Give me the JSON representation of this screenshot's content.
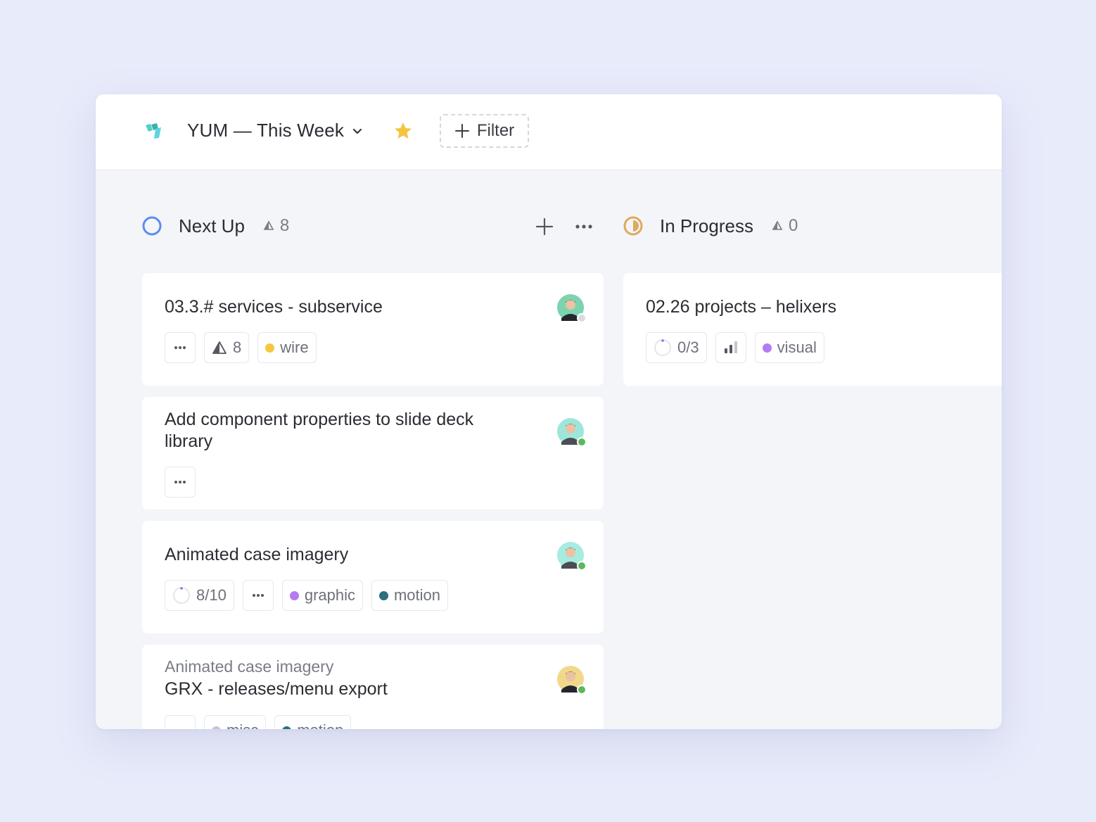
{
  "header": {
    "board_title": "YUM — This Week",
    "filter_label": "Filter"
  },
  "columns": [
    {
      "name": "Next Up",
      "count": "8",
      "status_color": "#5b8def",
      "cards": [
        {
          "title": "03.3.# services - subservice",
          "estimate": "8",
          "tags": [
            {
              "label": "wire",
              "color": "#f5c842"
            }
          ],
          "assignee_bg": "#7dd3b0",
          "presence_color": "#d9dbe0"
        },
        {
          "title_line1": "Add component properties to slide deck",
          "title_line2": "library",
          "assignee_bg": "#9ee6dc",
          "presence_color": "#5cb85c"
        },
        {
          "title": "Animated case imagery",
          "progress": "8/10",
          "tags": [
            {
              "label": "graphic",
              "color": "#b57bf0"
            },
            {
              "label": "motion",
              "color": "#2e6e7e"
            }
          ],
          "assignee_bg": "#a6ece0",
          "presence_color": "#5cb85c"
        },
        {
          "subtitle": "Animated case imagery",
          "title": "GRX - releases/menu export",
          "tags": [
            {
              "label": "misc",
              "color": "#c4c6cc"
            },
            {
              "label": "motion",
              "color": "#2e6e7e"
            }
          ],
          "assignee_bg": "#f2d88a",
          "presence_color": "#5cb85c"
        }
      ]
    },
    {
      "name": "In Progress",
      "count": "0",
      "status_color": "#e0a95c",
      "cards": [
        {
          "title": "02.26 projects – helixers",
          "progress": "0/3",
          "tags": [
            {
              "label": "visual",
              "color": "#b57bf0"
            }
          ]
        }
      ]
    }
  ],
  "icons": {
    "logo": "app-logo-icon",
    "star": "star-icon",
    "add": "plus-icon",
    "more": "ellipsis-icon",
    "estimate": "triangle-estimate-icon",
    "priority": "bar-chart-icon",
    "progress": "progress-ring-icon"
  }
}
